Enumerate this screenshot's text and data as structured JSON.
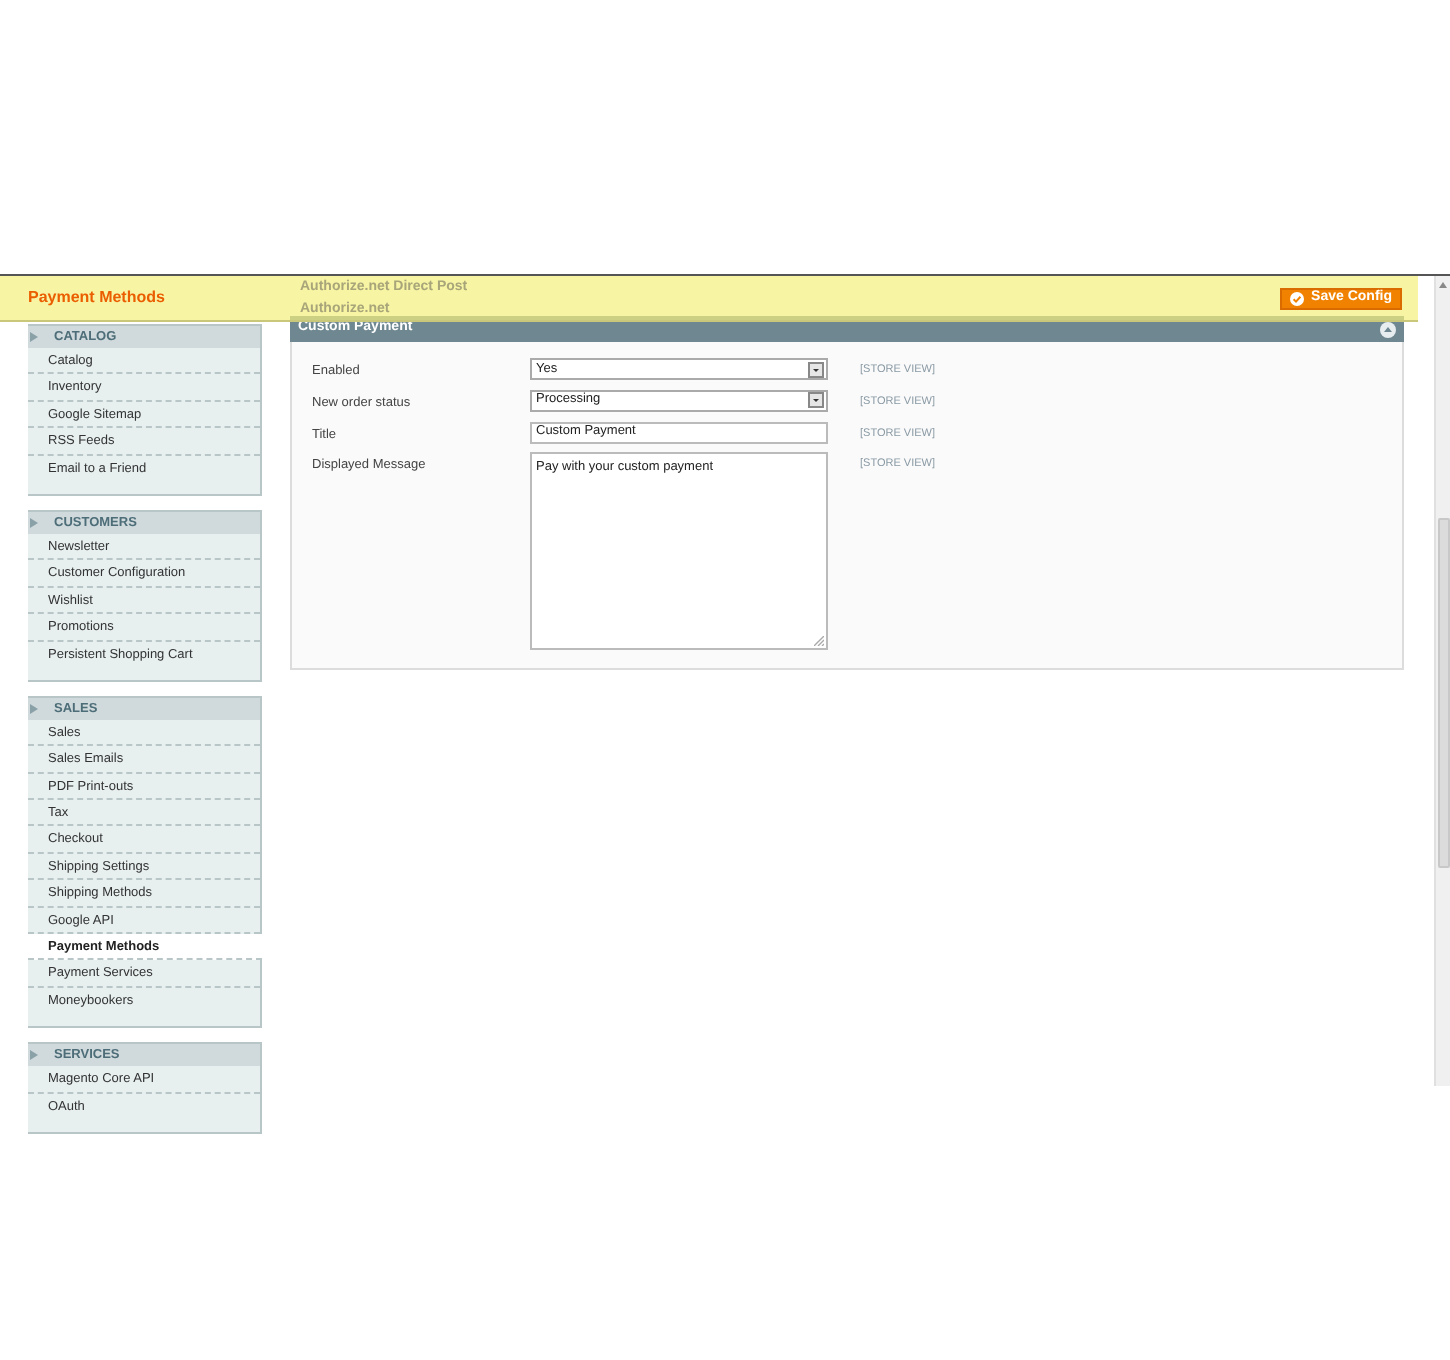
{
  "header": {
    "title": "Payment Methods",
    "save_button": "Save Config",
    "behind": [
      "Authorize.net Direct Post",
      "Authorize.net"
    ]
  },
  "sidebar": [
    {
      "title": "CATALOG",
      "items": [
        {
          "label": "Catalog",
          "selected": false
        },
        {
          "label": "Inventory",
          "selected": false
        },
        {
          "label": "Google Sitemap",
          "selected": false
        },
        {
          "label": "RSS Feeds",
          "selected": false
        },
        {
          "label": "Email to a Friend",
          "selected": false
        }
      ]
    },
    {
      "title": "CUSTOMERS",
      "items": [
        {
          "label": "Newsletter",
          "selected": false
        },
        {
          "label": "Customer Configuration",
          "selected": false
        },
        {
          "label": "Wishlist",
          "selected": false
        },
        {
          "label": "Promotions",
          "selected": false
        },
        {
          "label": "Persistent Shopping Cart",
          "selected": false
        }
      ]
    },
    {
      "title": "SALES",
      "items": [
        {
          "label": "Sales",
          "selected": false
        },
        {
          "label": "Sales Emails",
          "selected": false
        },
        {
          "label": "PDF Print-outs",
          "selected": false
        },
        {
          "label": "Tax",
          "selected": false
        },
        {
          "label": "Checkout",
          "selected": false
        },
        {
          "label": "Shipping Settings",
          "selected": false
        },
        {
          "label": "Shipping Methods",
          "selected": false
        },
        {
          "label": "Google API",
          "selected": false
        },
        {
          "label": "Payment Methods",
          "selected": true
        },
        {
          "label": "Payment Services",
          "selected": false
        },
        {
          "label": "Moneybookers",
          "selected": false
        }
      ]
    },
    {
      "title": "SERVICES",
      "items": [
        {
          "label": "Magento Core API",
          "selected": false
        },
        {
          "label": "OAuth",
          "selected": false
        }
      ]
    }
  ],
  "section": {
    "title": "Custom Payment",
    "fields": [
      {
        "kind": "select",
        "label": "Enabled",
        "value": "Yes",
        "scope": "[STORE VIEW]"
      },
      {
        "kind": "select",
        "label": "New order status",
        "value": "Processing",
        "scope": "[STORE VIEW]"
      },
      {
        "kind": "text",
        "label": "Title",
        "value": "Custom Payment",
        "scope": "[STORE VIEW]"
      },
      {
        "kind": "textarea",
        "label": "Displayed Message",
        "value": "Pay with your custom payment",
        "scope": "[STORE VIEW]"
      }
    ]
  }
}
